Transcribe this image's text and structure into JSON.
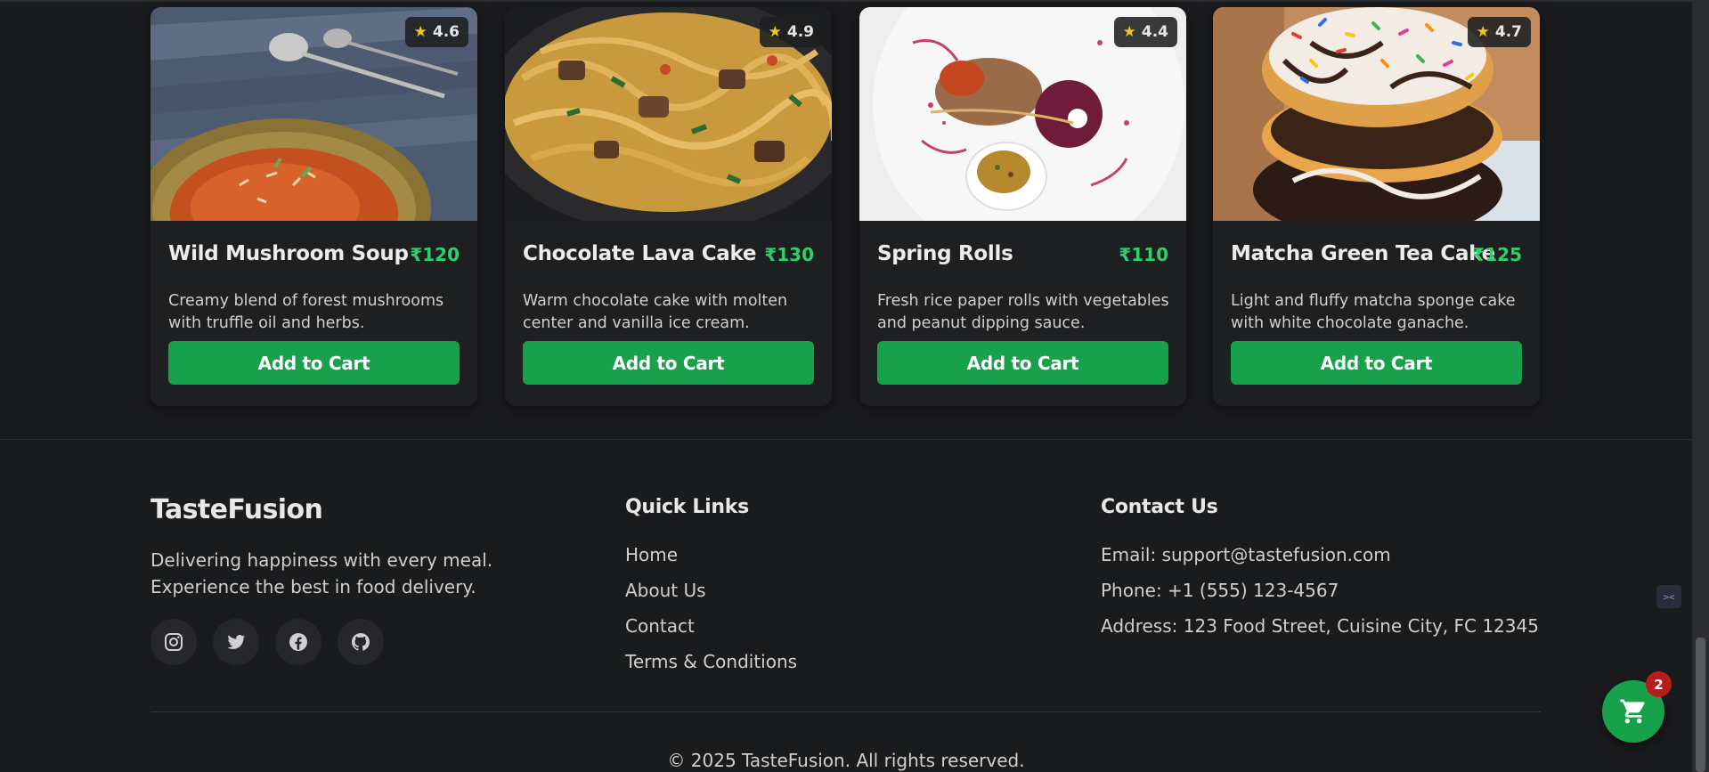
{
  "colors": {
    "background": "#1a1b1d",
    "card": "#1e1f21",
    "accent_green": "#16a14a",
    "price_green": "#2ed06e",
    "star": "#f5c518",
    "badge_red": "#b71c1c"
  },
  "cards": [
    {
      "title": "Wild Mushroom Soup",
      "price": "₹120",
      "rating": "4.6",
      "description": "Creamy blend of forest mushrooms with truffle oil and herbs.",
      "button": "Add to Cart"
    },
    {
      "title": "Chocolate Lava Cake",
      "price": "₹130",
      "rating": "4.9",
      "description": "Warm chocolate cake with molten center and vanilla ice cream.",
      "button": "Add to Cart"
    },
    {
      "title": "Spring Rolls",
      "price": "₹110",
      "rating": "4.4",
      "description": "Fresh rice paper rolls with vegetables and peanut dipping sauce.",
      "button": "Add to Cart"
    },
    {
      "title": "Matcha Green Tea Cake",
      "price": "₹125",
      "rating": "4.7",
      "description": "Light and fluffy matcha sponge cake with white chocolate ganache.",
      "button": "Add to Cart"
    }
  ],
  "footer": {
    "brand": "TasteFusion",
    "tagline": "Delivering happiness with every meal. Experience the best in food delivery.",
    "social_icons": [
      "instagram-icon",
      "twitter-icon",
      "facebook-icon",
      "github-icon"
    ],
    "quick_links": {
      "title": "Quick Links",
      "items": [
        "Home",
        "About Us",
        "Contact",
        "Terms & Conditions"
      ]
    },
    "contact": {
      "title": "Contact Us",
      "email": "Email: support@tastefusion.com",
      "phone": "Phone: +1 (555) 123-4567",
      "address": "Address: 123 Food Street, Cuisine City, FC 12345"
    },
    "copyright": "© 2025 TasteFusion. All rights reserved."
  },
  "cart": {
    "count": "2",
    "icon": "cart-icon"
  }
}
